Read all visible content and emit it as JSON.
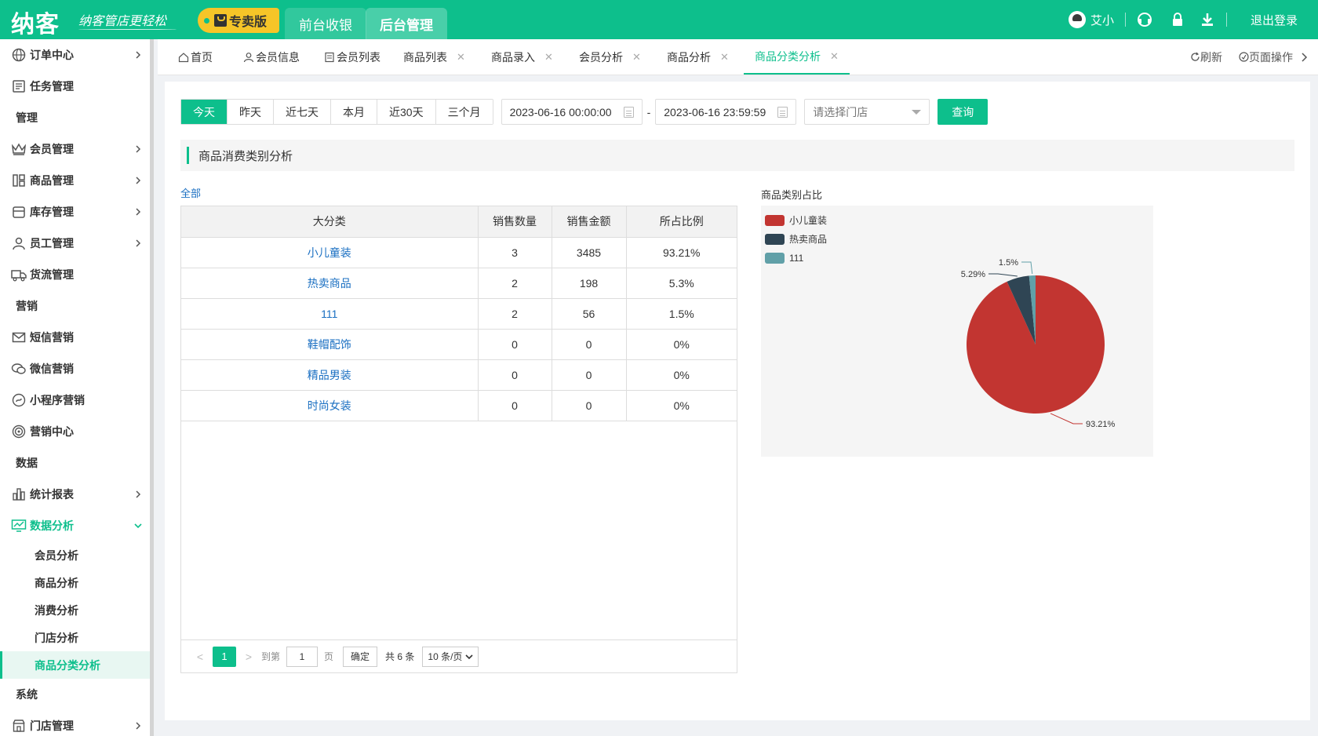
{
  "header": {
    "logo": "纳客",
    "slogan": "纳客管店更轻松",
    "edition": "专卖版",
    "nav": [
      {
        "label": "前台收银"
      },
      {
        "label": "后台管理"
      }
    ],
    "user": "艾小",
    "logout": "退出登录"
  },
  "sidebar": {
    "items": [
      {
        "label": "订单中心",
        "icon": "globe-icon"
      },
      {
        "label": "任务管理",
        "icon": "task-icon"
      },
      {
        "group": "管理"
      },
      {
        "label": "会员管理",
        "icon": "crown-icon"
      },
      {
        "label": "商品管理",
        "icon": "goods-icon"
      },
      {
        "label": "库存管理",
        "icon": "inventory-icon"
      },
      {
        "label": "员工管理",
        "icon": "person-icon"
      },
      {
        "label": "货流管理",
        "icon": "truck-icon"
      },
      {
        "group": "营销"
      },
      {
        "label": "短信营销",
        "icon": "mail-icon"
      },
      {
        "label": "微信营销",
        "icon": "wechat-icon"
      },
      {
        "label": "小程序营销",
        "icon": "miniapp-icon"
      },
      {
        "label": "营销中心",
        "icon": "target-icon"
      },
      {
        "group": "数据"
      },
      {
        "label": "统计报表",
        "icon": "bar-chart-icon"
      },
      {
        "label": "数据分析",
        "icon": "monitor-chart-icon"
      }
    ],
    "subitems": [
      "会员分析",
      "商品分析",
      "消费分析",
      "门店分析",
      "商品分类分析"
    ],
    "group_system": "系统",
    "store_mgmt": "门店管理"
  },
  "tabs": [
    {
      "label": "首页"
    },
    {
      "label": "会员信息"
    },
    {
      "label": "会员列表"
    },
    {
      "label": "商品列表"
    },
    {
      "label": "商品录入"
    },
    {
      "label": "会员分析"
    },
    {
      "label": "商品分析"
    },
    {
      "label": "商品分类分析"
    }
  ],
  "tab_actions": {
    "refresh": "刷新",
    "page_ops": "页面操作"
  },
  "filters": {
    "ranges": [
      "今天",
      "昨天",
      "近七天",
      "本月",
      "近30天",
      "三个月"
    ],
    "start": "2023-06-16 00:00:00",
    "end": "2023-06-16 23:59:59",
    "dash": "-",
    "store_placeholder": "请选择门店",
    "query": "查询"
  },
  "section_title": "商品消费类别分析",
  "all_link": "全部",
  "table": {
    "headers": [
      "大分类",
      "销售数量",
      "销售金额",
      "所占比例"
    ],
    "rows": [
      [
        "小儿童装",
        "3",
        "3485",
        "93.21%"
      ],
      [
        "热卖商品",
        "2",
        "198",
        "5.3%"
      ],
      [
        "111",
        "2",
        "56",
        "1.5%"
      ],
      [
        "鞋帽配饰",
        "0",
        "0",
        "0%"
      ],
      [
        "精品男装",
        "0",
        "0",
        "0%"
      ],
      [
        "时尚女装",
        "0",
        "0",
        "0%"
      ]
    ]
  },
  "pager": {
    "prev": "<",
    "current": "1",
    "next": ">",
    "goto": "到第",
    "page_input": "1",
    "page_unit": "页",
    "confirm": "确定",
    "total": "共 6 条",
    "page_size": "10 条/页"
  },
  "chart_data": {
    "type": "pie",
    "title": "商品类别占比",
    "slices": [
      {
        "name": "小儿童装",
        "value": 93.21,
        "label": "93.21%",
        "color": "#c23531"
      },
      {
        "name": "热卖商品",
        "value": 5.29,
        "label": "5.29%",
        "color": "#2f4554"
      },
      {
        "name": "111",
        "value": 1.5,
        "label": "1.5%",
        "color": "#61a0a8"
      }
    ],
    "legend": "top-left"
  }
}
